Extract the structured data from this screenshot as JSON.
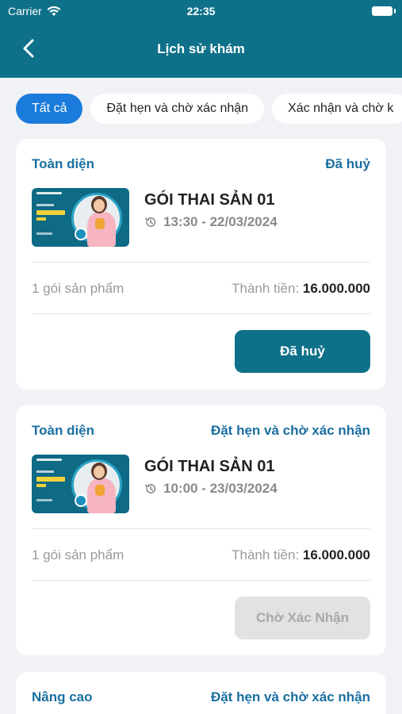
{
  "status_bar": {
    "carrier": "Carrier",
    "time": "22:35"
  },
  "header": {
    "title": "Lịch sử khám",
    "back_icon": "chevron-left-icon"
  },
  "tabs": [
    {
      "label": "Tất cả",
      "active": true
    },
    {
      "label": "Đặt hẹn và chờ xác nhận",
      "active": false
    },
    {
      "label": "Xác nhận và chờ k",
      "active": false
    }
  ],
  "orders": [
    {
      "category": "Toàn diện",
      "status": "Đã huỷ",
      "package_name": "GÓI THAI SẢN 01",
      "datetime": "13:30 - 22/03/2024",
      "count": "1 gói sản phẩm",
      "total_label": "Thành tiền:",
      "total_value": "16.000.000",
      "action": "Đã huỷ"
    },
    {
      "category": "Toàn diện",
      "status": "Đặt hẹn và chờ xác nhận",
      "package_name": "GÓI THAI SẢN 01",
      "datetime": "10:00 - 23/03/2024",
      "count": "1 gói sản phẩm",
      "total_label": "Thành tiền:",
      "total_value": "16.000.000",
      "action": "Chờ Xác Nhận"
    },
    {
      "category": "Nâng cao",
      "status": "Đặt hẹn và chờ xác nhận"
    }
  ],
  "colors": {
    "brand": "#0f7189",
    "accent_tab": "#1a7bdc",
    "link": "#1a6fa0"
  }
}
